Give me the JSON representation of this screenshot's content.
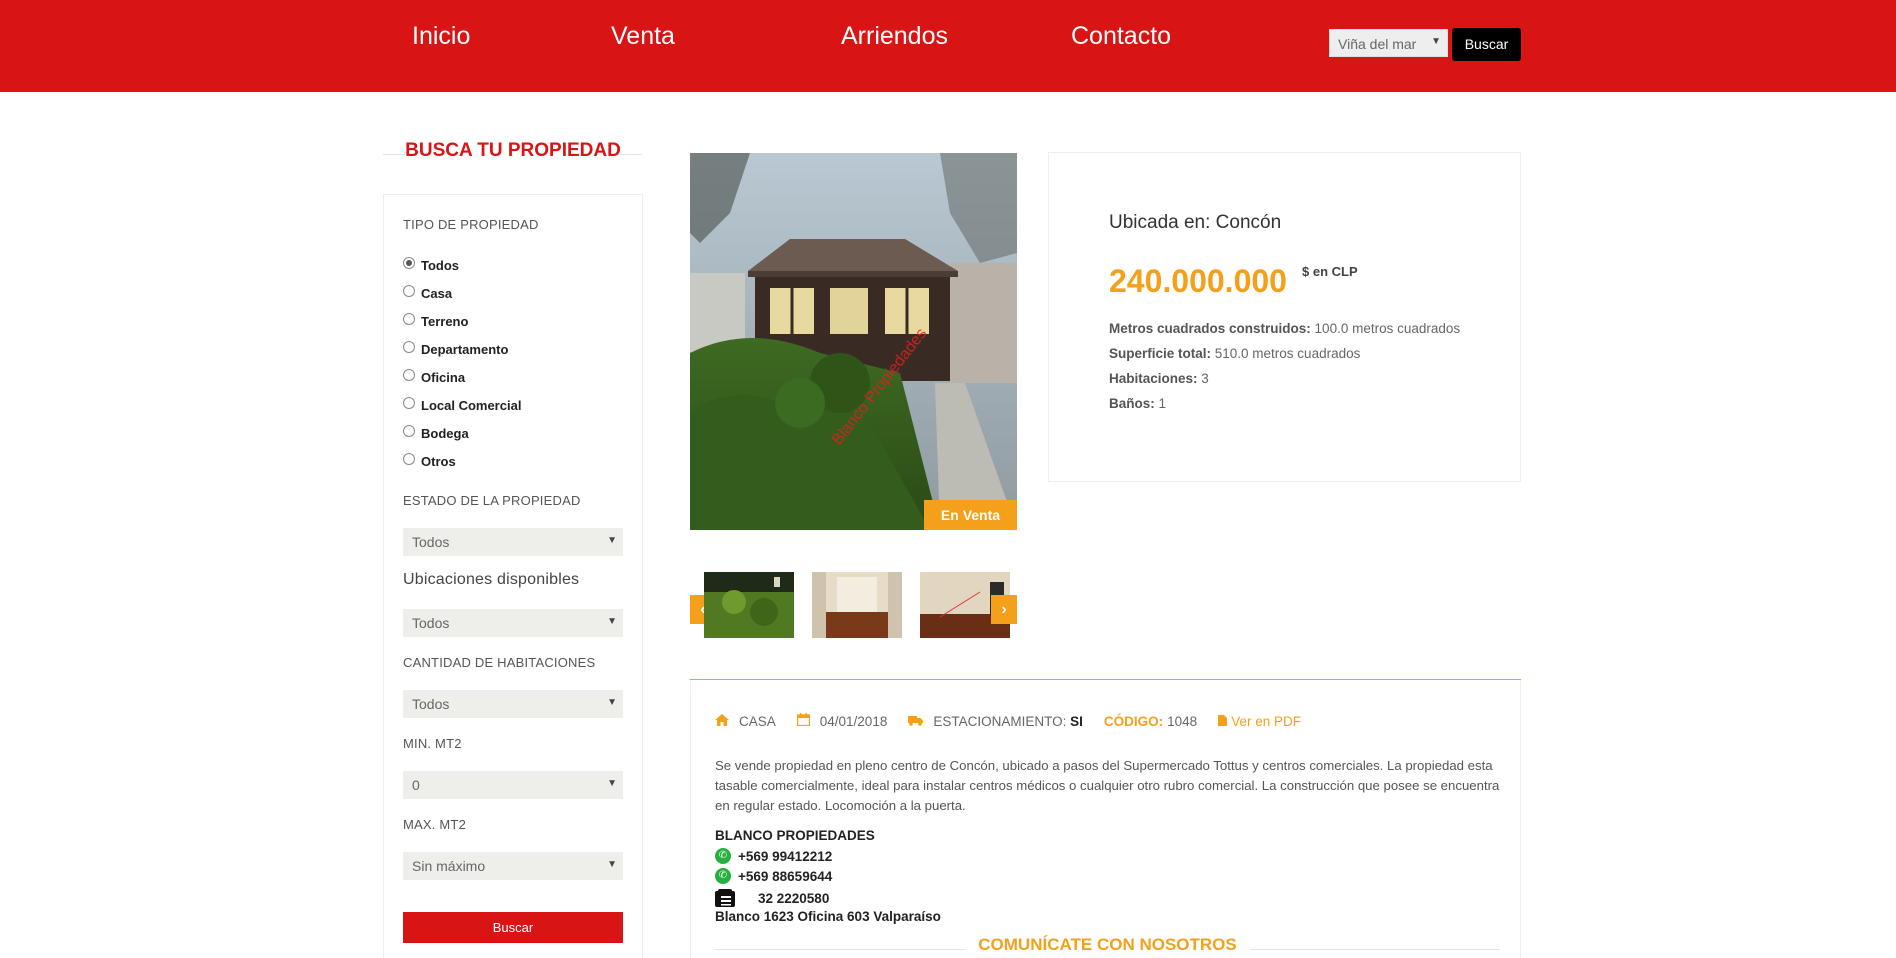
{
  "nav": {
    "items": [
      "Inicio",
      "Venta",
      "Arriendos",
      "Contacto"
    ],
    "city_value": "Viña del mar",
    "search_label": "Buscar"
  },
  "sidebar": {
    "title": "BUSCA TU PROPIEDAD",
    "tipo_label": "TIPO DE PROPIEDAD",
    "tipos": [
      "Todos",
      "Casa",
      "Terreno",
      "Departamento",
      "Oficina",
      "Local Comercial",
      "Bodega",
      "Otros"
    ],
    "tipo_selected": "Todos",
    "estado_label": "ESTADO DE LA PROPIEDAD",
    "estado_value": "Todos",
    "ubicaciones_label": "Ubicaciones disponibles",
    "ubicaciones_value": "Todos",
    "habitaciones_label": "CANTIDAD DE HABITACIONES",
    "habitaciones_value": "Todos",
    "min_label": "MIN. MT2",
    "min_value": "0",
    "max_label": "MAX. MT2",
    "max_value": "Sin máximo",
    "button": "Buscar"
  },
  "listing": {
    "badge": "En Venta",
    "ubicada": "Ubicada en: Concón",
    "price": "240.000.000",
    "currency": "$ en CLP",
    "specs": [
      {
        "label": "Metros cuadrados construidos:",
        "value": " 100.0 metros cuadrados"
      },
      {
        "label": "Superficie total:",
        "value": " 510.0 metros cuadrados"
      },
      {
        "label": "Habitaciones:",
        "value": " 3"
      },
      {
        "label": "Baños:",
        "value": " 1"
      }
    ],
    "meta": {
      "type": "CASA",
      "date": "04/01/2018",
      "parking_label": "ESTACIONAMIENTO:",
      "parking_value": "SI",
      "code_label": "CÓDIGO:",
      "code_value": "1048",
      "pdf": "Ver en PDF"
    },
    "description": "Se vende propiedad en pleno centro de Concón, ubicado a pasos del Supermercado Tottus y centros comerciales. La propiedad esta tasable comercialmente, ideal para instalar centros médicos o cualquier otro rubro comercial. La construcción que posee se encuentra en regular estado. Locomoción a la puerta.",
    "company": "BLANCO PROPIEDADES",
    "phone1": "+569 99412212",
    "phone2": "+569 88659644",
    "landline": "32 2220580",
    "address": "Blanco 1623 Oficina 603 Valparaíso",
    "contact_heading": "COMUNÍCATE CON NOSOTROS",
    "watermark": "Blanco Propiedades"
  },
  "colors": {
    "brand_red": "#d91414",
    "accent_orange": "#f5a01a"
  }
}
